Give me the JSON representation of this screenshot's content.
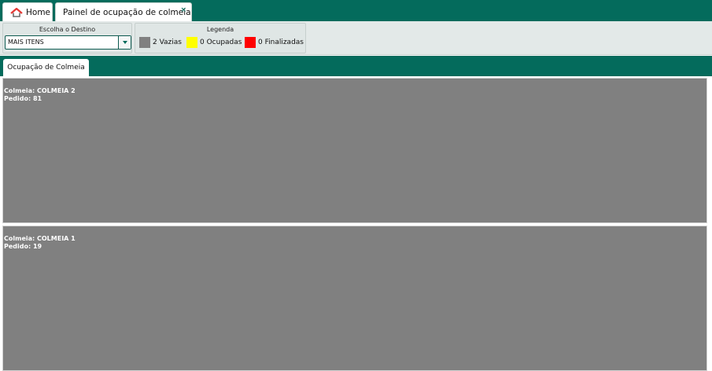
{
  "tabs": {
    "home_label": "Home",
    "painel_label": "Painel de ocupação de colmeia",
    "close_glyph": "×"
  },
  "filters": {
    "destination_title": "Escolha o Destino",
    "destination_value": "MAIS ITENS",
    "legend_title": "Legenda",
    "legend": [
      {
        "label": "2 Vazias",
        "color": "#808080"
      },
      {
        "label": "0 Ocupadas",
        "color": "#ffff00"
      },
      {
        "label": "0 Finalizadas",
        "color": "#ff0000"
      }
    ]
  },
  "section": {
    "tab_label": "Ocupação de Colmeia"
  },
  "colmeias": [
    {
      "name_line": "Colmeia: COLMEIA 2",
      "order_line": "Pedido: 81",
      "status": "Vazia",
      "color": "#808080"
    },
    {
      "name_line": "Colmeia: COLMEIA 1",
      "order_line": "Pedido: 19",
      "status": "Vazia",
      "color": "#808080"
    }
  ],
  "colors": {
    "brand": "#046b5c",
    "home_icon": "#e53935"
  },
  "icons": {
    "home": "home-icon",
    "close": "close-icon",
    "dropdown": "chevron-down-icon"
  }
}
